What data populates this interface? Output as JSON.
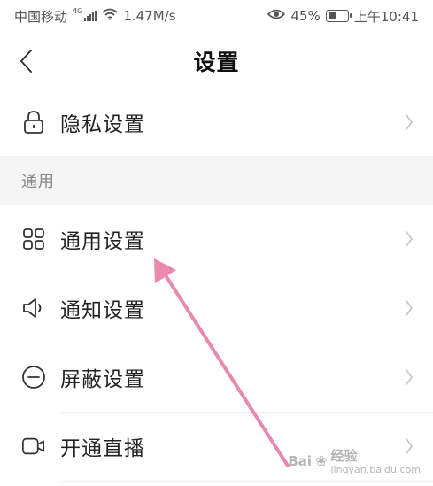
{
  "status_bar": {
    "carrier": "中国移动",
    "network_type": "4G",
    "speed": "1.47M/s",
    "battery_percent": "45%",
    "battery_level": 0.45,
    "time": "上午10:41"
  },
  "nav": {
    "title": "设置"
  },
  "rows": {
    "privacy": {
      "label": "隐私设置",
      "icon": "lock-icon"
    },
    "general": {
      "label": "通用设置",
      "icon": "grid-icon"
    },
    "notification": {
      "label": "通知设置",
      "icon": "speaker-icon"
    },
    "block": {
      "label": "屏蔽设置",
      "icon": "minus-circle-icon"
    },
    "live": {
      "label": "开通直播",
      "icon": "video-camera-icon"
    }
  },
  "section": {
    "general_header": "通用"
  },
  "annotation": {
    "arrow_color": "#e889ad"
  },
  "watermark": {
    "brand": "Bai",
    "brand_tail": "经验",
    "sub": "jingyan.baidu.com"
  }
}
